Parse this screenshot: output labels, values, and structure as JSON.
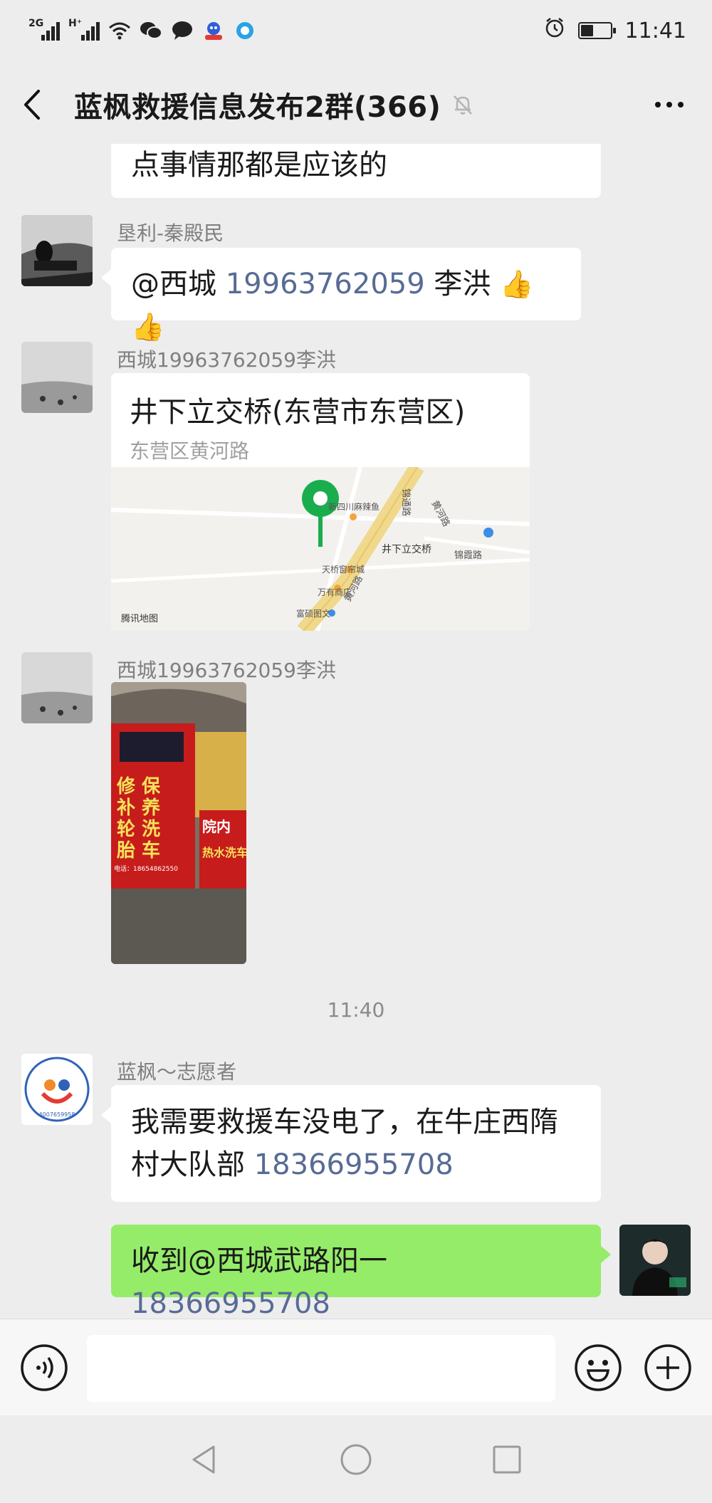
{
  "status_bar": {
    "signal1": "2G",
    "signal2": "H⁺",
    "time": "11:41",
    "battery_level": 0.45
  },
  "header": {
    "title": "蓝枫救援信息发布2群(366)"
  },
  "messages": {
    "m0": {
      "text": "点事情那都是应该的"
    },
    "m1": {
      "sender": "垦利-秦殿民",
      "text": "@西城 ",
      "phone": "19963762059",
      "tail": " 李洪 ",
      "emoji": "👍👍"
    },
    "m2": {
      "sender": "西城19963762059李洪",
      "title": "井下立交桥(东营市东营区)",
      "subtitle": "东营区黄河路",
      "map_labels": {
        "poi1": "新四川麻辣鱼",
        "bridge": "井下立交桥",
        "poi2": "天桥窗帘城",
        "poi3": "万有商店",
        "road_v": "锦通路",
        "road_diag1": "黄河路",
        "road_diag2": "黄河路",
        "road_e": "锦霞路",
        "road_s": "富硕图文",
        "logo": "腾讯地图"
      }
    },
    "m3": {
      "sender": "西城19963762059李洪",
      "photo_text": {
        "line1": "修 保",
        "line2": "补 养",
        "line3": "轮 洗",
        "line4": "胎 车",
        "phone": "电话：18654862550",
        "sign2a": "院内",
        "sign2b": "热水洗车"
      }
    },
    "timestamp": "11:40",
    "m4": {
      "sender": "蓝枫～志愿者",
      "line1": "我需要救援车没电了，在牛庄西隋",
      "line2_prefix": "村大队部 ",
      "phone": "18366955708",
      "avatar_text": "4007659958"
    },
    "m5": {
      "prefix": "收到@西城武路阳一",
      "phone": "18366955708"
    }
  },
  "input_bar": {
    "voice_icon": "voice-icon",
    "emoji_icon": "emoji-icon",
    "plus_icon": "plus-icon"
  },
  "colors": {
    "background": "#ededed",
    "bubble_self": "#95ec69",
    "link": "#576b95",
    "map_pin": "#1aad4e"
  }
}
